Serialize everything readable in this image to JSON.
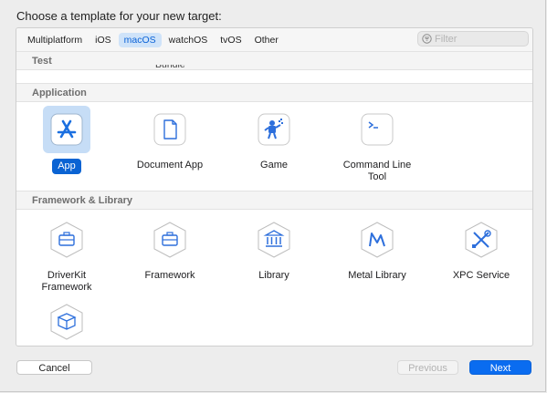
{
  "dialog": {
    "heading": "Choose a template for your new target:"
  },
  "tabs": [
    {
      "label": "Multiplatform"
    },
    {
      "label": "iOS"
    },
    {
      "label": "macOS"
    },
    {
      "label": "watchOS"
    },
    {
      "label": "tvOS"
    },
    {
      "label": "Other"
    }
  ],
  "selected_tab": "macOS",
  "filter": {
    "placeholder": "Filter",
    "icon": "filter-icon"
  },
  "sections": {
    "test": {
      "title": "Test",
      "partial_item": "Bundle"
    },
    "application": {
      "title": "Application",
      "items": [
        {
          "label": "App",
          "icon": "app-store-icon",
          "selected": true
        },
        {
          "label": "Document App",
          "icon": "document-icon"
        },
        {
          "label": "Game",
          "icon": "game-icon"
        },
        {
          "label_line1": "Command Line",
          "label_line2": "Tool",
          "icon": "terminal-icon"
        }
      ]
    },
    "framework": {
      "title": "Framework & Library",
      "items": [
        {
          "label_line1": "DriverKit",
          "label_line2": "Framework",
          "icon": "toolbox-icon"
        },
        {
          "label": "Framework",
          "icon": "toolbox-icon"
        },
        {
          "label": "Library",
          "icon": "library-icon"
        },
        {
          "label": "Metal Library",
          "icon": "metal-icon"
        },
        {
          "label": "XPC Service",
          "icon": "xpc-tools-icon"
        },
        {
          "label": "",
          "icon": "package-icon"
        }
      ]
    }
  },
  "buttons": {
    "cancel": "Cancel",
    "previous": "Previous",
    "next": "Next"
  },
  "colors": {
    "accent": "#0a6cf0",
    "selection_bg": "#c6ddf6",
    "tab_selected_bg": "#cfe3f9"
  }
}
